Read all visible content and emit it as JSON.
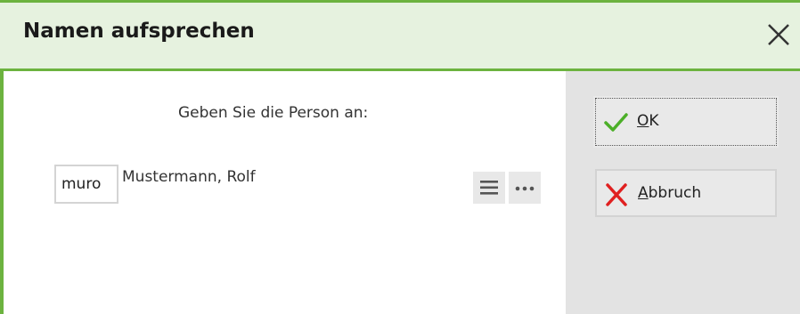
{
  "dialog": {
    "title": "Namen aufsprechen",
    "prompt": "Geben Sie die Person an:",
    "person": {
      "code": "muro",
      "name": "Mustermann, Rolf"
    },
    "buttons": {
      "ok": {
        "mnemonic": "O",
        "rest": "K"
      },
      "cancel": {
        "mnemonic": "A",
        "rest": "bbruch"
      }
    },
    "icons": {
      "close": "close-icon",
      "list": "list-icon",
      "more": "more-icon",
      "ok": "checkmark-icon",
      "cancel": "cross-icon"
    },
    "colors": {
      "accent": "#6cb33f",
      "title_bg": "#e6f2df",
      "ok_icon": "#4caf28",
      "cancel_icon": "#e02020",
      "side_panel": "#e3e3e3"
    }
  }
}
